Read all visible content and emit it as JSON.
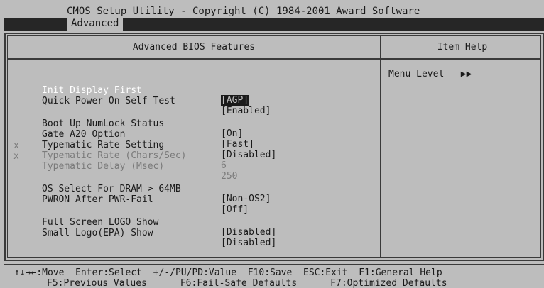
{
  "header": {
    "title": "CMOS Setup Utility - Copyright (C) 1984-2001 Award Software",
    "tab": "Advanced"
  },
  "panel": {
    "left_title": "Advanced BIOS Features",
    "right_title": "Item Help"
  },
  "settings": [
    {
      "marker": "",
      "label": "Init Display First",
      "value": "[AGP]",
      "state": "selected"
    },
    {
      "marker": "",
      "label": "Quick Power On Self Test",
      "value": "[Enabled]",
      "state": "normal"
    },
    {
      "marker": "",
      "label": "Boot Up NumLock Status",
      "value": "[On]",
      "state": "normal"
    },
    {
      "marker": "",
      "label": "Gate A20 Option",
      "value": "[Fast]",
      "state": "normal"
    },
    {
      "marker": "",
      "label": "Typematic Rate Setting",
      "value": "[Disabled]",
      "state": "normal"
    },
    {
      "marker": "x",
      "label": "Typematic Rate (Chars/Sec)",
      "value": "6",
      "state": "disabled"
    },
    {
      "marker": "x",
      "label": "Typematic Delay (Msec)",
      "value": "250",
      "state": "disabled"
    },
    {
      "marker": "",
      "label": "OS Select For DRAM > 64MB",
      "value": "[Non-OS2]",
      "state": "normal"
    },
    {
      "marker": "",
      "label": "PWRON After PWR-Fail",
      "value": "[Off]",
      "state": "normal"
    },
    {
      "marker": "",
      "label": "Full Screen LOGO Show",
      "value": "[Disabled]",
      "state": "normal"
    },
    {
      "marker": "",
      "label": "Small Logo(EPA) Show",
      "value": "[Disabled]",
      "state": "normal"
    }
  ],
  "help": {
    "menu_level": "Menu Level   ▶▶"
  },
  "footer": {
    "line1": "↑↓→←:Move  Enter:Select  +/-/PU/PD:Value  F10:Save  ESC:Exit  F1:General Help",
    "line2": "F5:Previous Values      F6:Fail-Safe Defaults      F7:Optimized Defaults"
  },
  "colors": {
    "background": "#bdbdbd",
    "text": "#1a1a1a",
    "disabled_text": "#7a7a7a",
    "highlight_text": "#ffffff",
    "bar": "#262626"
  }
}
